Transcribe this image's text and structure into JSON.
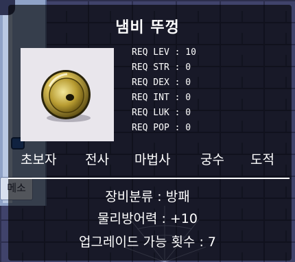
{
  "side_panel": {
    "label": "메소"
  },
  "item": {
    "name": "냄비 뚜껑",
    "icon": "pot-lid-shield-icon"
  },
  "requirements": [
    {
      "label": "REQ LEV",
      "value": "10"
    },
    {
      "label": "REQ STR",
      "value": "0"
    },
    {
      "label": "REQ DEX",
      "value": "0"
    },
    {
      "label": "REQ INT",
      "value": "0"
    },
    {
      "label": "REQ LUK",
      "value": "0"
    },
    {
      "label": "REQ POP",
      "value": "0"
    }
  ],
  "jobs": [
    "초보자",
    "전사",
    "마법사",
    "궁수",
    "도적"
  ],
  "stats": {
    "category_line": "장비분류 : 방패",
    "defense_line": "물리방어력 : +10",
    "upgrades_line": "업그레이드 가능 횟수 : 7"
  },
  "colors": {
    "text": "#ffffff",
    "tooltip_bg": "#000000",
    "icon_bg": "#e9e6ec",
    "shield_gold": "#c9b24a"
  }
}
